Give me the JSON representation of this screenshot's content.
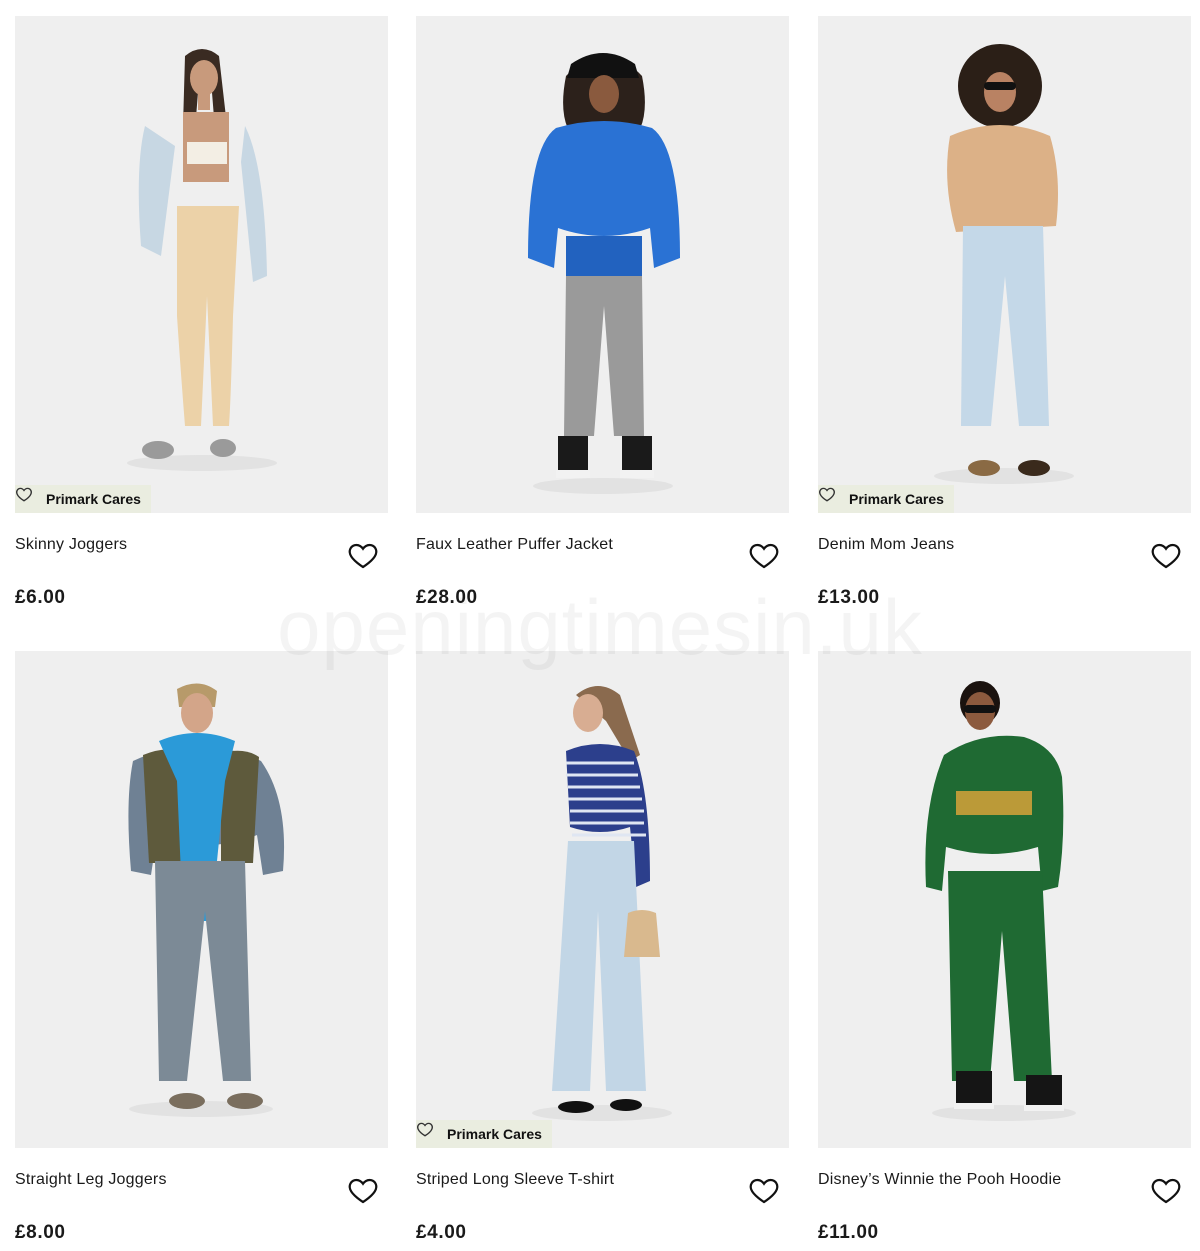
{
  "badge_label": "Primark Cares",
  "watermark": "openingtimesin.uk",
  "products": [
    {
      "name": "Skinny Joggers",
      "price": "£6.00",
      "badge": true
    },
    {
      "name": "Faux Leather Puffer Jacket",
      "price": "£28.00",
      "badge": false
    },
    {
      "name": "Denim Mom Jeans",
      "price": "£13.00",
      "badge": true
    },
    {
      "name": "Straight Leg Joggers",
      "price": "£8.00",
      "badge": false
    },
    {
      "name": "Striped Long Sleeve T-shirt",
      "price": "£4.00",
      "badge": true
    },
    {
      "name": "Disney’s Winnie the Pooh Hoodie",
      "price": "£11.00",
      "badge": false
    }
  ],
  "icons": {
    "favourite": "heart-outline-icon",
    "badge": "heart-outline-icon"
  },
  "colors": {
    "image_bg": "#efefef",
    "badge_bg": "#e9ecde",
    "text": "#1a1a1a"
  }
}
